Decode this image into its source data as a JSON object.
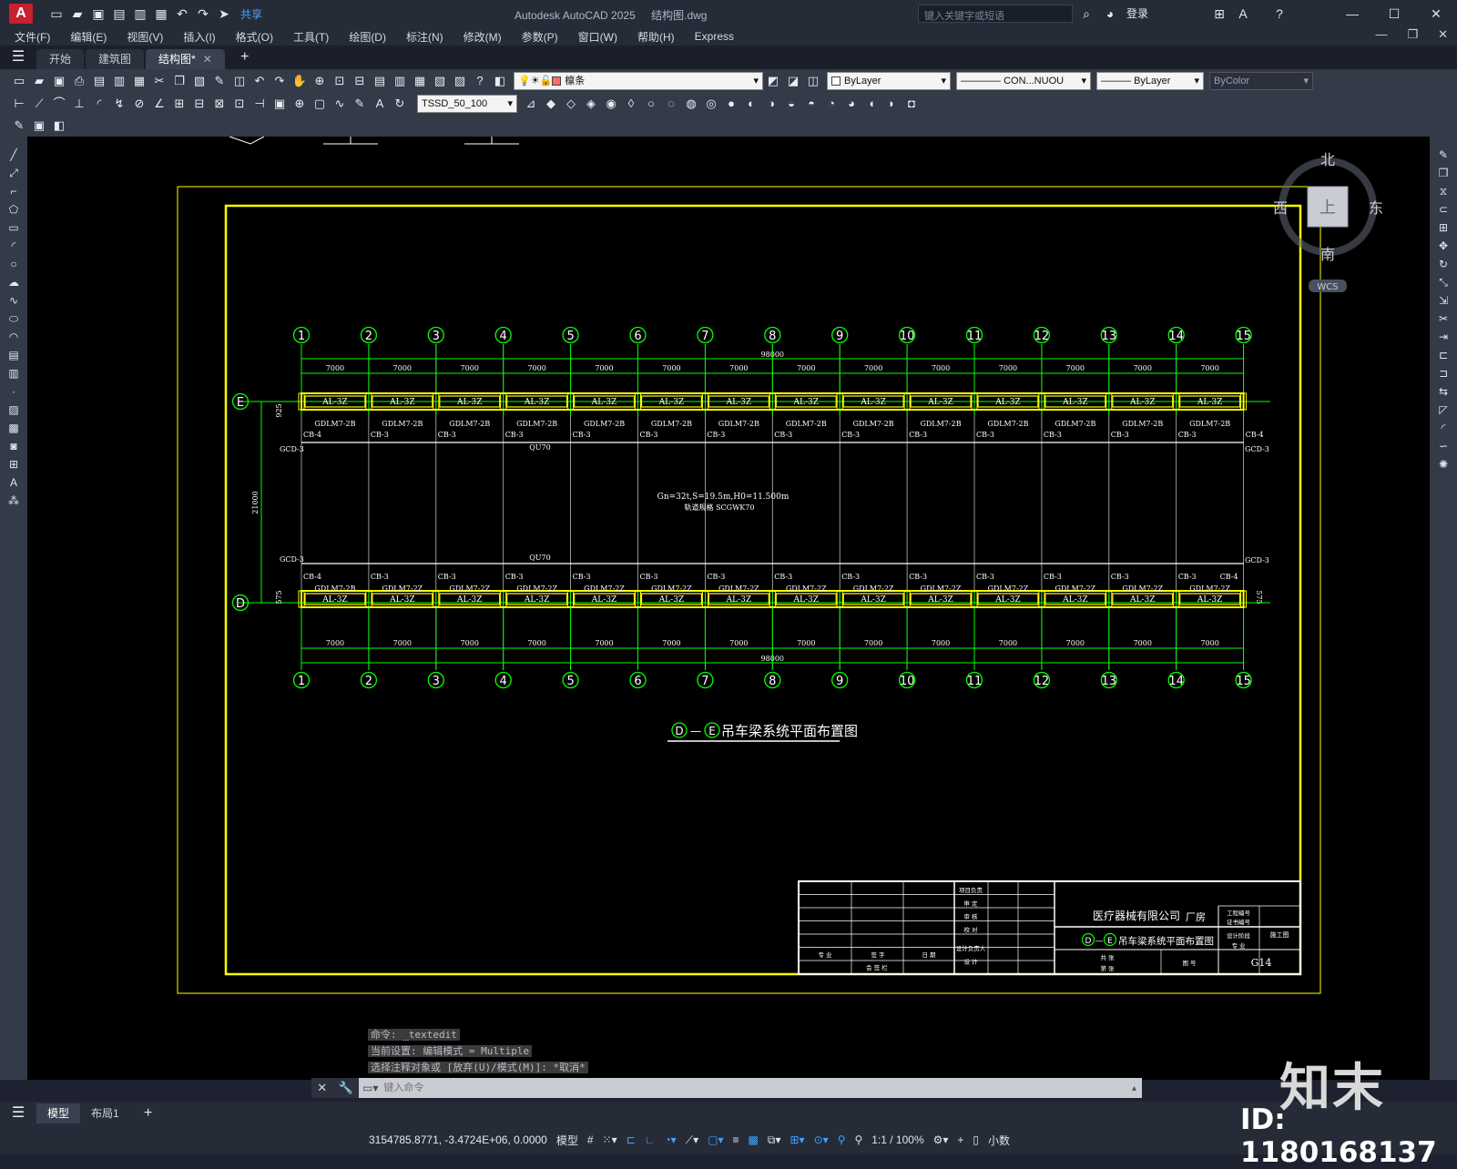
{
  "titlebar": {
    "app_title": "Autodesk AutoCAD 2025",
    "file_title": "结构图.dwg",
    "share_label": "共享",
    "search_placeholder": "键入关键字或短语",
    "login_label": "登录"
  },
  "menu": [
    "文件(F)",
    "编辑(E)",
    "视图(V)",
    "插入(I)",
    "格式(O)",
    "工具(T)",
    "绘图(D)",
    "标注(N)",
    "修改(M)",
    "参数(P)",
    "窗口(W)",
    "帮助(H)",
    "Express"
  ],
  "file_tabs": [
    {
      "label": "开始",
      "active": false
    },
    {
      "label": "建筑图",
      "active": false
    },
    {
      "label": "结构图*",
      "active": true
    }
  ],
  "toolbar": {
    "layer_name": "檩条",
    "color": "ByLayer",
    "linetype": "CON...NUOU",
    "lineweight": "ByLayer",
    "plotstyle": "ByColor",
    "dimstyle": "TSSD_50_100"
  },
  "viewcube": {
    "north": "北",
    "south": "南",
    "east": "东",
    "west": "西",
    "top": "上",
    "wcs": "WCS"
  },
  "drawing": {
    "axis_numbers": [
      "1",
      "2",
      "3",
      "4",
      "5",
      "6",
      "7",
      "8",
      "9",
      "10",
      "11",
      "12",
      "13",
      "14",
      "15"
    ],
    "axis_rows": [
      "E",
      "D"
    ],
    "span_label": "7000",
    "total_label": "98000",
    "height_label": "21000",
    "left_top_dim": "925",
    "left_bot_dim": "575",
    "right_bot_dim": "575",
    "beam_label_top": "AL-3Z",
    "beam_label_bot": "AL-3Z",
    "rail_top": "GDLM7-2B",
    "rail_bot": "GDLM7-2Z",
    "rail_bot_first": "GDLM7-2B",
    "cb_end": "CB-4",
    "cb_mid": "CB-3",
    "gcd": "GCD-3",
    "rail_track": "QU70",
    "crane_note_1": "Gn=32t,S=19.5m,H0=11.500m",
    "crane_note_2": "轨道规格 SCGWK70",
    "plan_title_prefix_d": "D",
    "plan_title_dash": "—",
    "plan_title_prefix_e": "E",
    "plan_title": "吊车梁系统平面布置图"
  },
  "title_block": {
    "company": "医疗器械有限公司",
    "project": "厂房",
    "drawing_name": "吊车梁系统平面布置图",
    "stage": "施工图",
    "drawing_no": "G14",
    "row_labels": [
      "项目负责",
      "审 定",
      "审 核",
      "校 对",
      "设计负责人",
      "设 计"
    ],
    "right_labels": [
      "工程编号",
      "证书编号",
      "设计阶段",
      "专 业",
      "共 张",
      "第 张",
      "图 号"
    ],
    "bottom_labels": [
      "专 业",
      "签 字",
      "日 期",
      "会 签 栏"
    ]
  },
  "command_history": [
    "命令: _textedit",
    "当前设置: 编辑模式 = Multiple",
    "选择注释对象或 [放弃(U)/模式(M)]: *取消*"
  ],
  "command_placeholder": "键入命令",
  "layout_tabs": [
    {
      "label": "模型",
      "active": true
    },
    {
      "label": "布局1",
      "active": false
    }
  ],
  "status": {
    "coords": "3154785.8771, -3.4724E+06, 0.0000",
    "model": "模型",
    "scale": "1:1 / 100%",
    "units": "小数"
  },
  "watermark": {
    "logo": "知末",
    "id": "ID: 1180168137"
  },
  "colors": {
    "axis_green": "#00ff00",
    "frame_yellow": "#ffff00",
    "text_white": "#ffffff"
  }
}
